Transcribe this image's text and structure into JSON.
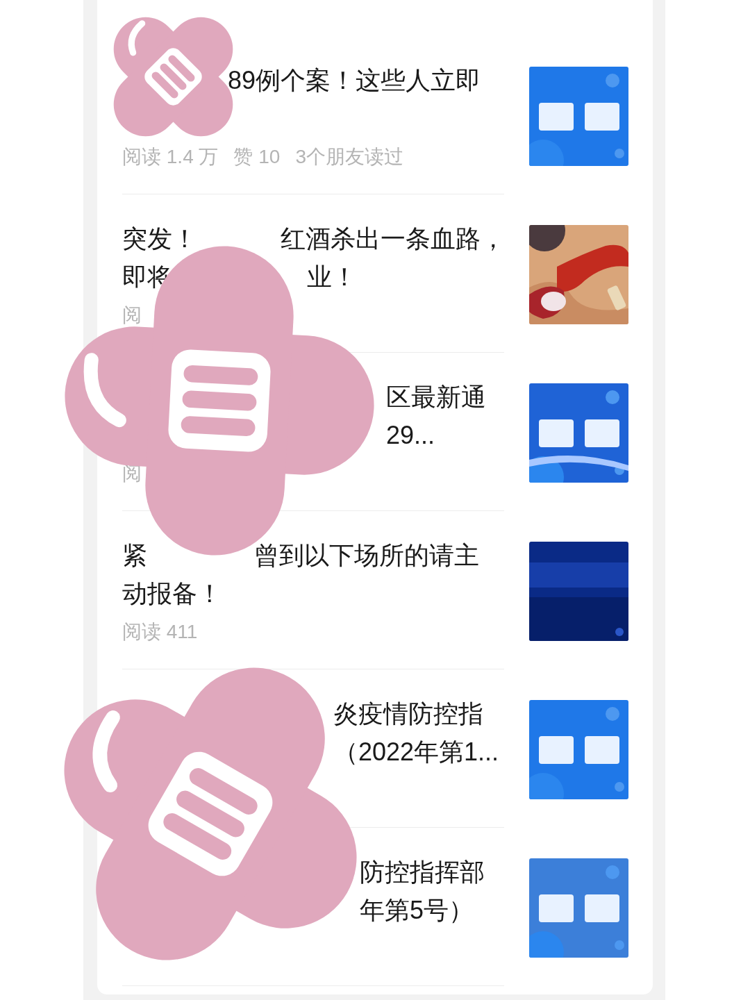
{
  "articles": [
    {
      "title_lines": [
        [
          "89例个案！这些人立即"
        ]
      ],
      "stats": [
        "阅读 1.4 万",
        "赞 10",
        "3个朋友读过"
      ]
    },
    {
      "title_lines": [
        [
          "突发！",
          "红酒杀出一条血路，"
        ],
        [
          "即将",
          "业！"
        ]
      ],
      "stats": [
        "阅"
      ]
    },
    {
      "title_lines": [
        [
          "区最新通"
        ],
        [
          "29..."
        ]
      ],
      "stats": [
        "阅"
      ]
    },
    {
      "title_lines": [
        [
          "紧",
          "曾到以下场所的请主"
        ],
        [
          "动报备！"
        ]
      ],
      "stats": [
        "阅读 411"
      ]
    },
    {
      "title_lines": [
        [
          "炎疫情防控指"
        ],
        [
          "（2022年第1..."
        ]
      ]
    },
    {
      "title_lines": [
        [
          "防控指挥部"
        ],
        [
          "年第5号）"
        ]
      ]
    }
  ]
}
